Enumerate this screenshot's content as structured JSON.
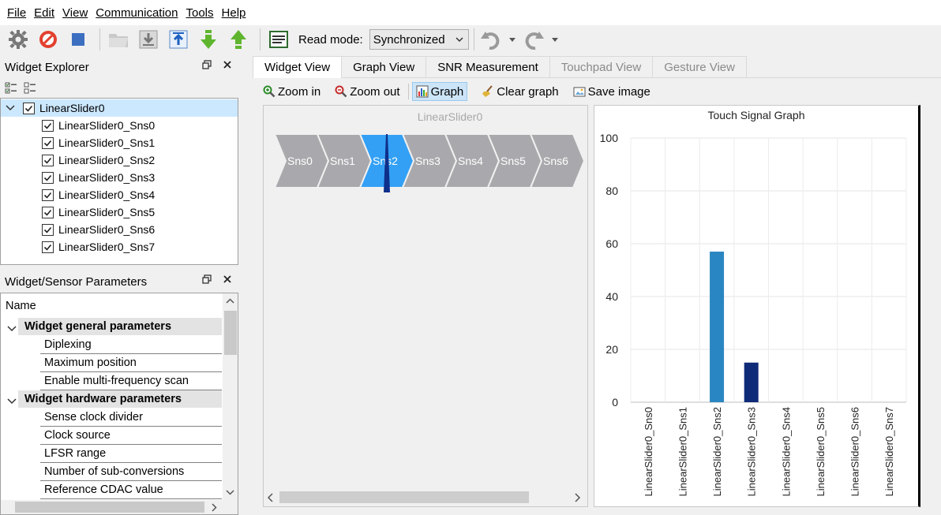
{
  "menu": [
    "File",
    "Edit",
    "View",
    "Communication",
    "Tools",
    "Help"
  ],
  "toolbar": {
    "read_mode_label": "Read mode:",
    "read_mode_value": "Synchronized"
  },
  "widget_explorer": {
    "title": "Widget Explorer",
    "root": "LinearSlider0",
    "sensors": [
      "LinearSlider0_Sns0",
      "LinearSlider0_Sns1",
      "LinearSlider0_Sns2",
      "LinearSlider0_Sns3",
      "LinearSlider0_Sns4",
      "LinearSlider0_Sns5",
      "LinearSlider0_Sns6",
      "LinearSlider0_Sns7"
    ]
  },
  "params": {
    "title": "Widget/Sensor Parameters",
    "name_header": "Name",
    "sections": [
      {
        "label": "Widget general parameters",
        "items": [
          "Diplexing",
          "Maximum position",
          "Enable multi-frequency scan"
        ]
      },
      {
        "label": "Widget hardware parameters",
        "items": [
          "Sense clock divider",
          "Clock source",
          "LFSR range",
          "Number of sub-conversions",
          "Reference CDAC value"
        ]
      }
    ]
  },
  "tabs": [
    {
      "label": "Widget View",
      "state": "active"
    },
    {
      "label": "Graph View",
      "state": "normal"
    },
    {
      "label": "SNR Measurement",
      "state": "normal"
    },
    {
      "label": "Touchpad View",
      "state": "disabled"
    },
    {
      "label": "Gesture View",
      "state": "disabled"
    }
  ],
  "subtoolbar": {
    "zoom_in": "Zoom in",
    "zoom_out": "Zoom out",
    "graph": "Graph",
    "clear_graph": "Clear graph",
    "save_image": "Save image"
  },
  "slider": {
    "title": "LinearSlider0",
    "segments": [
      "Sns0",
      "Sns1",
      "Sns2",
      "Sns3",
      "Sns4",
      "Sns5",
      "Sns6"
    ],
    "active_segment": 2,
    "colors": {
      "segment": "#a9a9ad",
      "active": "#33a0f5",
      "pointer": "#0e2f8a"
    }
  },
  "chart_data": {
    "type": "bar",
    "title": "Touch Signal Graph",
    "categories": [
      "LinearSlider0_Sns0",
      "LinearSlider0_Sns1",
      "LinearSlider0_Sns2",
      "LinearSlider0_Sns3",
      "LinearSlider0_Sns4",
      "LinearSlider0_Sns5",
      "LinearSlider0_Sns6",
      "LinearSlider0_Sns7"
    ],
    "values": [
      0,
      0,
      57,
      15,
      0,
      0,
      0,
      0
    ],
    "bar_colors": [
      "#2a86c2",
      "#2a86c2",
      "#2a86c2",
      "#0f2a78",
      "#2a86c2",
      "#2a86c2",
      "#2a86c2",
      "#2a86c2"
    ],
    "ylim": [
      0,
      100
    ],
    "yticks": [
      0,
      20,
      40,
      60,
      80,
      100
    ],
    "grid": true
  }
}
